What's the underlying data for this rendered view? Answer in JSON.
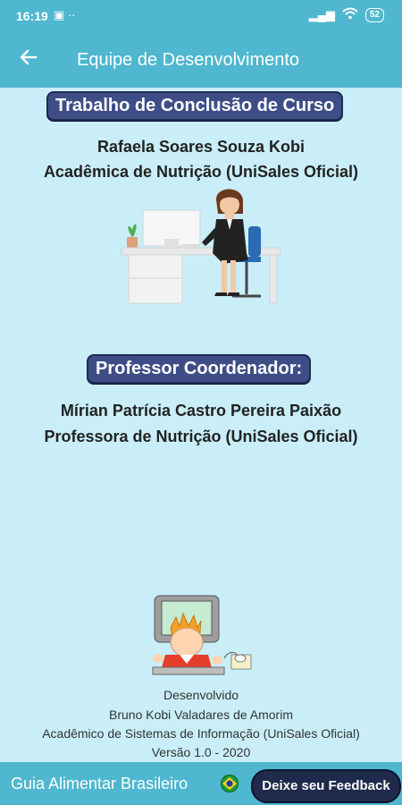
{
  "statusbar": {
    "time": "16:19",
    "left_icons": "▣ ··",
    "signal": "▂▄▆",
    "wifi": "wifi",
    "battery": "52"
  },
  "appbar": {
    "title": "Equipe de Desenvolvimento"
  },
  "section1": {
    "pill": "Trabalho de Conclusão de Curso",
    "name": "Rafaela Soares Souza Kobi",
    "role": "Acadêmica de Nutrição (UniSales Oficial)"
  },
  "section2": {
    "pill": "Professor Coordenador:",
    "name": "Mírian Patrícia Castro Pereira Paixão",
    "role": "Professora de Nutrição (UniSales Oficial)"
  },
  "footer": {
    "l1": "Desenvolvido",
    "l2": "Bruno Kobi Valadares de Amorim",
    "l3": "Acadêmico de Sistemas de Informação (UniSales Oficial)",
    "l4": "Versão 1.0  - 2020"
  },
  "bottombar": {
    "app_name": "Guia Alimentar Brasileiro",
    "feedback": "Deixe seu Feedback"
  },
  "colors": {
    "header": "#4fb7cf",
    "background": "#c9eef8",
    "pill": "#3f4d86",
    "button": "#1f2a4d"
  },
  "icons": [
    "back-arrow-icon",
    "signal-icon",
    "wifi-icon",
    "battery-icon",
    "brazil-flag-icon"
  ]
}
